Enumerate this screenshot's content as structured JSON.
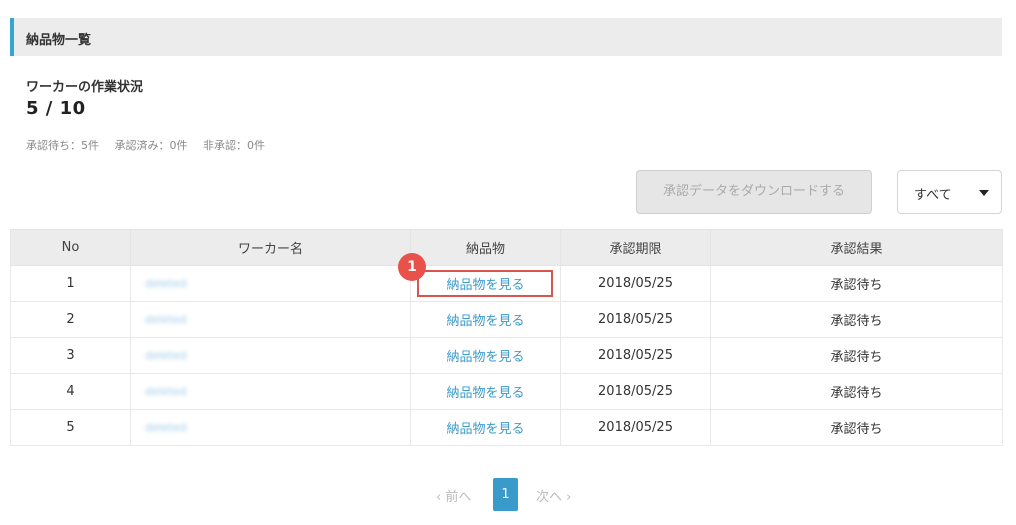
{
  "header": {
    "title": "納品物一覧"
  },
  "status": {
    "label": "ワーカーの作業状況",
    "count": "5 / 10",
    "pending": "承認待ち：5件",
    "approved": "承認済み：0件",
    "rejected": "非承認：0件"
  },
  "toolbar": {
    "download_label": "承認データをダウンロードする",
    "filter_value": "すべて"
  },
  "table": {
    "columns": [
      "No",
      "ワーカー名",
      "納品物",
      "承認期限",
      "承認結果"
    ],
    "rows": [
      {
        "no": "1",
        "worker": "deleted",
        "deliverable": "納品物を見る",
        "deadline": "2018/05/25",
        "result": "承認待ち"
      },
      {
        "no": "2",
        "worker": "deleted",
        "deliverable": "納品物を見る",
        "deadline": "2018/05/25",
        "result": "承認待ち"
      },
      {
        "no": "3",
        "worker": "deleted",
        "deliverable": "納品物を見る",
        "deadline": "2018/05/25",
        "result": "承認待ち"
      },
      {
        "no": "4",
        "worker": "deleted",
        "deliverable": "納品物を見る",
        "deadline": "2018/05/25",
        "result": "承認待ち"
      },
      {
        "no": "5",
        "worker": "deleted",
        "deliverable": "納品物を見る",
        "deadline": "2018/05/25",
        "result": "承認待ち"
      }
    ]
  },
  "annotation": {
    "step": "1"
  },
  "pagination": {
    "prev": "‹ 前へ",
    "current": "1",
    "next": "次へ ›"
  },
  "colors": {
    "accent": "#35a6d0",
    "link": "#3a9ac9",
    "annotation": "#e8524a"
  }
}
